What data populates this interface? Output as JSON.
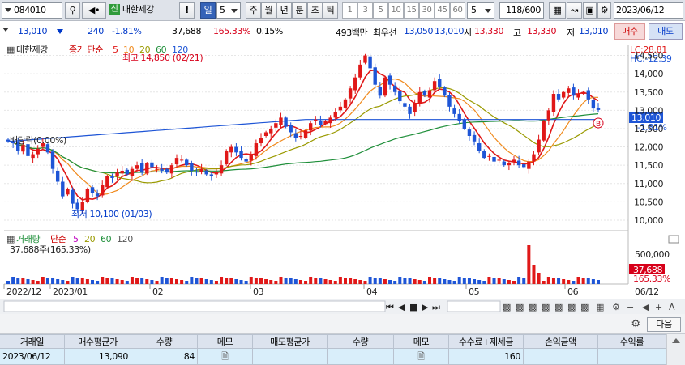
{
  "toolbar": {
    "code": "084010",
    "sin": "신",
    "name": "대한제강",
    "bang": "!",
    "day": "일",
    "num": "5",
    "periods": [
      "주",
      "월",
      "년",
      "분",
      "초",
      "틱"
    ],
    "nums": [
      "1",
      "3",
      "5",
      "10",
      "15",
      "30",
      "45",
      "60"
    ],
    "sel": "5",
    "count": "118/600",
    "date": "2023/06/12"
  },
  "quote": {
    "price": "13,010",
    "change": "240",
    "pct": "-1.81%",
    "volume": "37,688",
    "vol_ratio": "165.33%",
    "turnover": "0.15%",
    "amount": "493백만",
    "pref_lbl": "최우선",
    "pref_sell": "13,050",
    "pref_buy": "13,010",
    "open_lbl": "시",
    "open": "13,330",
    "high_lbl": "고",
    "high": "13,330",
    "low_lbl": "저",
    "low": "13,010",
    "buy_btn": "매수",
    "sell_btn": "매도"
  },
  "chart": {
    "price_title": "대한제강",
    "legend_type": "종가 단순",
    "ma_labels": [
      "5",
      "10",
      "20",
      "60",
      "120"
    ],
    "lc": "LC:28.81",
    "hc": "HC:-12.39",
    "high_note": "최고 14,850 (02/21)",
    "low_note": "최저 10,100 (01/03)",
    "dividend": "배당락(0.00%)",
    "ann_b": "B",
    "last_price": "13,010",
    "last_pct": "-1.81%",
    "yaxis": [
      "14,500",
      "14,000",
      "13,500",
      "13,000",
      "12,500",
      "12,000",
      "11,500",
      "11,000",
      "10,500",
      "10,000"
    ],
    "vol_title": "거래량",
    "vol_legend": "단순",
    "vol_ma": [
      "5",
      "20",
      "60",
      "120"
    ],
    "vol_value": "37,688주(165.33%)",
    "vol_axis": "500,000",
    "vol_last": "37,688",
    "vol_pct": "165.33%",
    "xaxis": [
      "2022/12",
      "2023/01",
      "02",
      "03",
      "04",
      "05",
      "06"
    ],
    "xend": "06/12",
    "minus": "−",
    "plus": "+",
    "A": "A"
  },
  "chart_data": {
    "type": "candlestick",
    "ylim": [
      9800,
      14800
    ],
    "closes": [
      12150,
      12100,
      11900,
      12050,
      11750,
      11800,
      11950,
      12100,
      11850,
      11400,
      11050,
      10650,
      10850,
      10450,
      10300,
      10500,
      10850,
      10750,
      10650,
      10950,
      11200,
      11150,
      11300,
      11350,
      11250,
      11400,
      11500,
      11300,
      11550,
      11450,
      11400,
      11350,
      11300,
      11500,
      11700,
      11650,
      11500,
      11350,
      11300,
      11400,
      11250,
      11200,
      11300,
      11500,
      11900,
      12000,
      11850,
      11700,
      11600,
      11800,
      12100,
      12250,
      12400,
      12500,
      12650,
      12800,
      12550,
      12400,
      12250,
      12300,
      12450,
      12650,
      12750,
      12600,
      12700,
      12800,
      12950,
      13100,
      13300,
      13600,
      13900,
      14250,
      14500,
      14150,
      13700,
      13400,
      13900,
      13700,
      13500,
      13250,
      13100,
      12900,
      13200,
      13500,
      13400,
      13550,
      13800,
      13650,
      13400,
      13100,
      12900,
      12700,
      12500,
      12300,
      12150,
      11900,
      11700,
      11750,
      11600,
      11650,
      11500,
      11550,
      11650,
      11500,
      11450,
      11600,
      11800,
      12200,
      12700,
      13000,
      13450,
      13300,
      13500,
      13600,
      13400,
      13450,
      13500,
      13300,
      13050,
      13010
    ],
    "vol_last_value": 37688
  },
  "table": {
    "gear": "⚙",
    "next": "다음",
    "headers": [
      "거래일",
      "매수평균가",
      "수량",
      "메모",
      "매도평균가",
      "수량",
      "메모",
      "수수료+제세금",
      "손익금액",
      "수익률"
    ],
    "row": [
      "2023/06/12",
      "13,090",
      "84",
      "",
      "",
      "",
      "",
      "160",
      "",
      ""
    ]
  }
}
